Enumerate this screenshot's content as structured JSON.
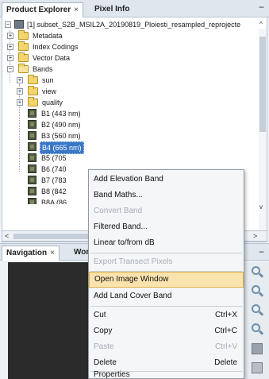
{
  "top_tabs": [
    {
      "label": "Product Explorer",
      "close": "×",
      "active": true
    },
    {
      "label": "Pixel Info",
      "active": false
    }
  ],
  "minimize_glyph": "−",
  "tree": {
    "product_label": "[1] subset_S2B_MSIL2A_20190819_Ploiesti_resampled_reprojecte",
    "nodes": [
      {
        "label": "Metadata",
        "icon": "folder-icon"
      },
      {
        "label": "Index Codings",
        "icon": "folder-icon"
      },
      {
        "label": "Vector Data",
        "icon": "folder-icon"
      },
      {
        "label": "Bands",
        "icon": "folder-open-icon"
      },
      {
        "label": "sun",
        "icon": "folder-icon"
      },
      {
        "label": "view",
        "icon": "folder-icon"
      },
      {
        "label": "quality",
        "icon": "folder-icon"
      },
      {
        "label": "B1 (443 nm)",
        "icon": "band-icon"
      },
      {
        "label": "B2 (490 nm)",
        "icon": "band-icon"
      },
      {
        "label": "B3 (560 nm)",
        "icon": "band-icon"
      },
      {
        "label": "B4 (665 nm)",
        "icon": "band-icon",
        "selected": true
      },
      {
        "label": "B5 (705",
        "icon": "band-icon"
      },
      {
        "label": "B6 (740",
        "icon": "band-icon"
      },
      {
        "label": "B7 (783",
        "icon": "band-icon"
      },
      {
        "label": "B8 (842",
        "icon": "band-icon"
      },
      {
        "label": "B8A (86",
        "icon": "band-icon"
      }
    ]
  },
  "bottom_tabs": [
    {
      "label": "Navigation",
      "close": "×",
      "active": true
    },
    {
      "label": "World",
      "active": false
    }
  ],
  "scroll_arrows": {
    "left": "<",
    "right": ">",
    "up": "^",
    "down": "v"
  },
  "context_menu": [
    {
      "label": "Add Elevation Band",
      "enabled": true
    },
    {
      "label": "Band Maths...",
      "enabled": true
    },
    {
      "label": "Convert Band",
      "enabled": false
    },
    {
      "label": "Filtered Band...",
      "enabled": true
    },
    {
      "label": "Linear to/from dB",
      "enabled": true
    },
    {
      "label": "Export Transect Pixels",
      "enabled": false
    },
    {
      "label": "Open Image Window",
      "enabled": true,
      "highlighted": true
    },
    {
      "label": "Add Land Cover Band",
      "enabled": true
    },
    {
      "label": "Cut",
      "shortcut": "Ctrl+X",
      "enabled": true
    },
    {
      "label": "Copy",
      "shortcut": "Ctrl+C",
      "enabled": true
    },
    {
      "label": "Paste",
      "shortcut": "Ctrl+V",
      "enabled": false
    },
    {
      "label": "Delete",
      "shortcut": "Delete",
      "enabled": true
    },
    {
      "label": "Properties",
      "enabled": true
    }
  ],
  "colors": {
    "selection": "#3a77c7",
    "menu_highlight": "#fbe3ae",
    "canvas": "#2b2b2b"
  }
}
